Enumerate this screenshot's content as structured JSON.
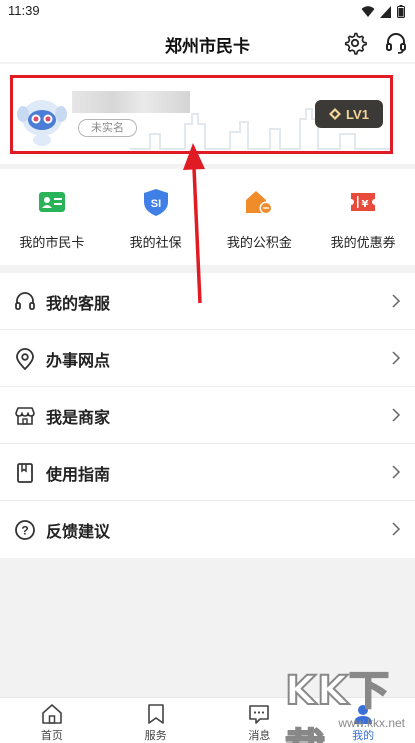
{
  "status": {
    "time": "11:39"
  },
  "header": {
    "title": "郑州市民卡",
    "settings_icon": "gear-icon",
    "service_icon": "headset-icon"
  },
  "profile": {
    "realname_badge": "未实名",
    "level": "LV1",
    "name_redacted": true
  },
  "quick_actions": [
    {
      "label": "我的市民卡",
      "icon": "citizen-card-icon",
      "color": "#2bb35a"
    },
    {
      "label": "我的社保",
      "icon": "social-security-icon",
      "color": "#3f7fe6"
    },
    {
      "label": "我的公积金",
      "icon": "housing-fund-icon",
      "color": "#f08c2a"
    },
    {
      "label": "我的优惠券",
      "icon": "coupon-icon",
      "color": "#e84a3c"
    }
  ],
  "menu": [
    {
      "label": "我的客服",
      "icon": "headset-icon"
    },
    {
      "label": "办事网点",
      "icon": "location-pin-icon"
    },
    {
      "label": "我是商家",
      "icon": "store-icon"
    },
    {
      "label": "使用指南",
      "icon": "book-icon"
    },
    {
      "label": "反馈建议",
      "icon": "question-icon"
    }
  ],
  "tabs": [
    {
      "label": "首页",
      "icon": "home-icon",
      "active": false
    },
    {
      "label": "服务",
      "icon": "bookmark-icon",
      "active": false
    },
    {
      "label": "消息",
      "icon": "message-icon",
      "active": false
    },
    {
      "label": "我的",
      "icon": "user-icon",
      "active": true
    }
  ],
  "watermark": {
    "main": "KK下载",
    "url": "www.kkx.net"
  },
  "colors": {
    "accent": "#3a6fd8",
    "highlight": "#e01b24",
    "level_bg": "#3c3a36",
    "level_text": "#f3d59a"
  }
}
